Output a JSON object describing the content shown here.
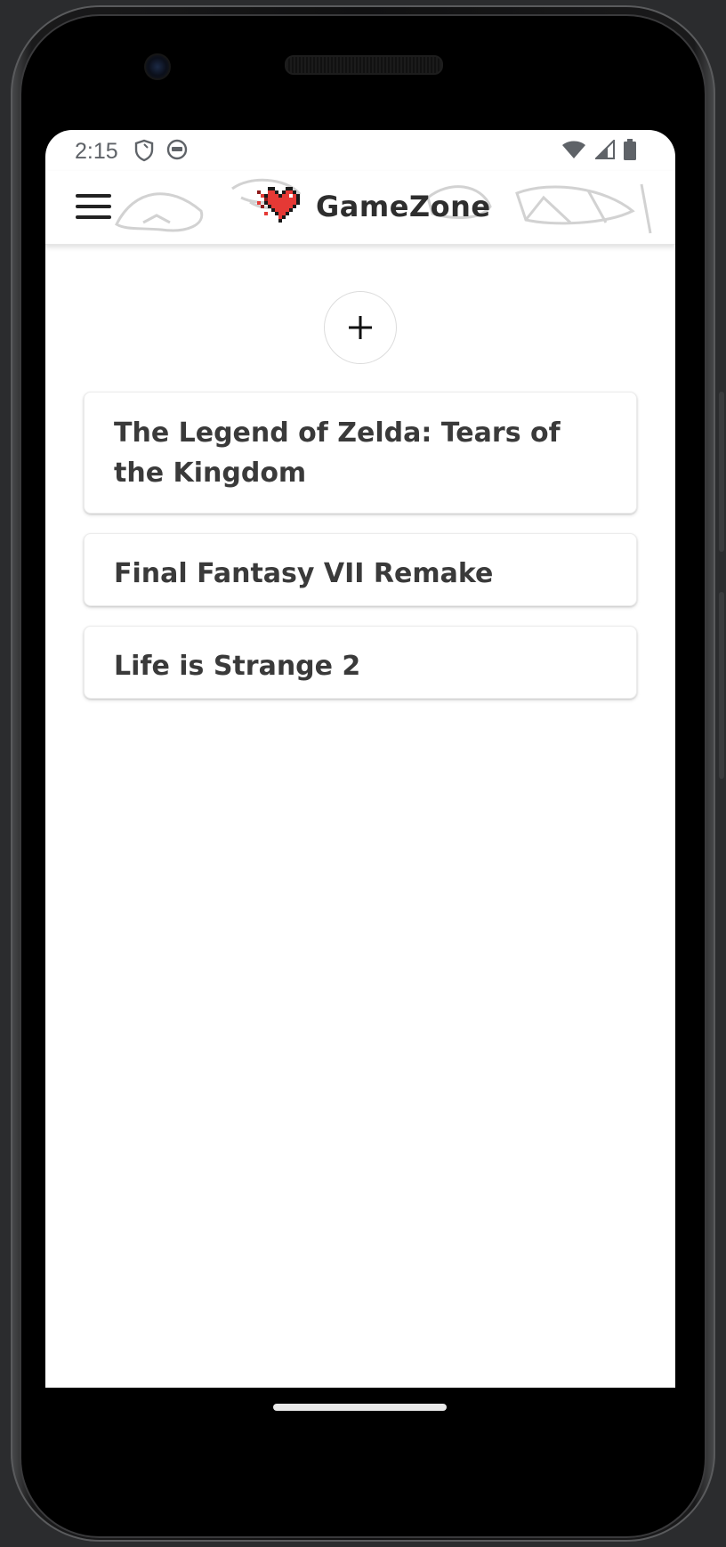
{
  "status_bar": {
    "time": "2:15",
    "left_icons": [
      "shield-icon",
      "android-face-icon"
    ],
    "right_icons": [
      "wifi-icon",
      "signal-icon",
      "battery-icon"
    ]
  },
  "app_bar": {
    "title": "GameZone",
    "logo_icon": "pixel-heart-icon",
    "menu_icon": "hamburger-menu-icon"
  },
  "add_button": {
    "icon": "plus-icon"
  },
  "games": [
    {
      "title": "The Legend of Zelda: Tears of the Kingdom"
    },
    {
      "title": "Final Fantasy VII Remake"
    },
    {
      "title": "Life is Strange 2"
    }
  ],
  "colors": {
    "heart_red": "#e53935",
    "heart_dark": "#8e1b1b",
    "text": "#3a3a3a",
    "background": "#ffffff"
  }
}
